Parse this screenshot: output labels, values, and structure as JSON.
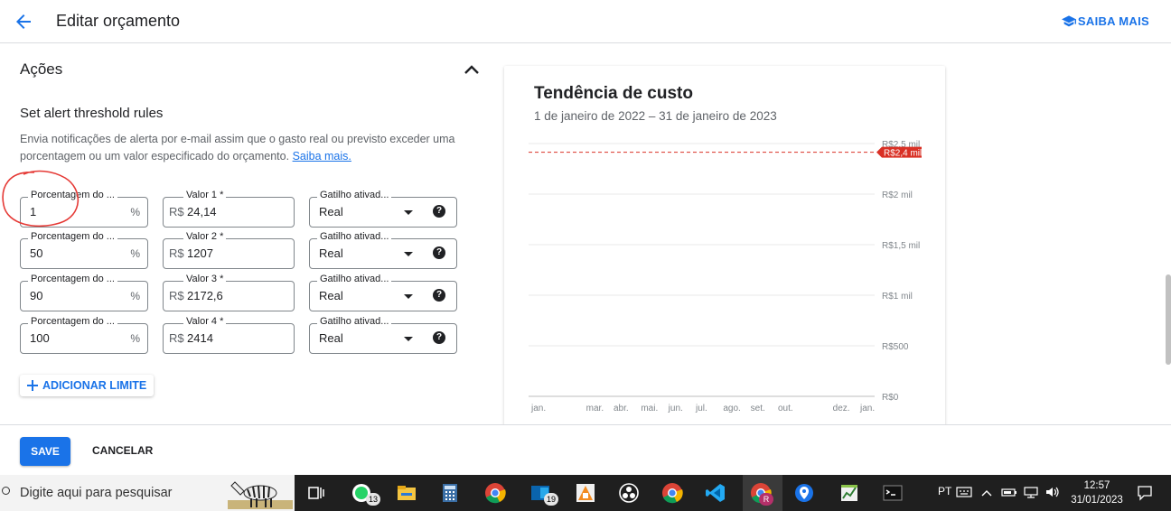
{
  "header": {
    "title": "Editar orçamento",
    "learn_more": "SAIBA MAIS"
  },
  "actions": {
    "section_title": "Ações",
    "subtitle": "Set alert threshold rules",
    "description": "Envia notificações de alerta por e-mail assim que o gasto real ou previsto exceder uma porcentagem ou um valor especificado do orçamento.",
    "description_link": "Saiba mais.",
    "rows": [
      {
        "percent_label": "Porcentagem do ...",
        "percent_value": "1",
        "percent_suffix": "%",
        "amount_label": "Valor 1 *",
        "amount_prefix": "R$",
        "amount_value": "24,14",
        "trigger_label": "Gatilho ativad...",
        "trigger_value": "Real"
      },
      {
        "percent_label": "Porcentagem do ...",
        "percent_value": "50",
        "percent_suffix": "%",
        "amount_label": "Valor 2 *",
        "amount_prefix": "R$",
        "amount_value": "1207",
        "trigger_label": "Gatilho ativad...",
        "trigger_value": "Real"
      },
      {
        "percent_label": "Porcentagem do ...",
        "percent_value": "90",
        "percent_suffix": "%",
        "amount_label": "Valor 3 *",
        "amount_prefix": "R$",
        "amount_value": "2172,6",
        "trigger_label": "Gatilho ativad...",
        "trigger_value": "Real"
      },
      {
        "percent_label": "Porcentagem do ...",
        "percent_value": "100",
        "percent_suffix": "%",
        "amount_label": "Valor 4 *",
        "amount_prefix": "R$",
        "amount_value": "2414",
        "trigger_label": "Gatilho ativad...",
        "trigger_value": "Real"
      }
    ],
    "add_limit": "ADICIONAR LIMITE"
  },
  "chart_card": {
    "title": "Tendência de custo",
    "subtitle": "1 de janeiro de 2022 – 31 de janeiro de 2023",
    "chart_data": {
      "type": "line",
      "x_labels": [
        "jan.",
        "mar.",
        "abr.",
        "mai.",
        "jun.",
        "jul.",
        "ago.",
        "set.",
        "out.",
        "dez.",
        "jan."
      ],
      "x_positions": [
        0,
        2,
        3,
        4,
        5,
        6,
        7,
        8,
        9,
        11,
        12
      ],
      "y_ticks": [
        "R$0",
        "R$500",
        "R$1 mil",
        "R$1,5 mil",
        "R$2 mil",
        "R$2,5 mil"
      ],
      "y_values": [
        0,
        500,
        1000,
        1500,
        2000,
        2500
      ],
      "ylim": [
        0,
        2500
      ],
      "budget_line": {
        "value": 2414,
        "label": "R$2,4 mil",
        "color": "#d93025"
      },
      "series": []
    }
  },
  "footer": {
    "save": "SAVE",
    "cancel": "CANCELAR"
  },
  "taskbar": {
    "search_placeholder": "Digite aqui para pesquisar",
    "whatsapp_badge": "13",
    "outlook_badge": "19",
    "chrome_profile_badge": "R",
    "language": "PT",
    "time": "12:57",
    "date": "31/01/2023"
  },
  "colors": {
    "accent": "#1a73e8",
    "annotation": "#e53935",
    "budget_line": "#d93025"
  }
}
